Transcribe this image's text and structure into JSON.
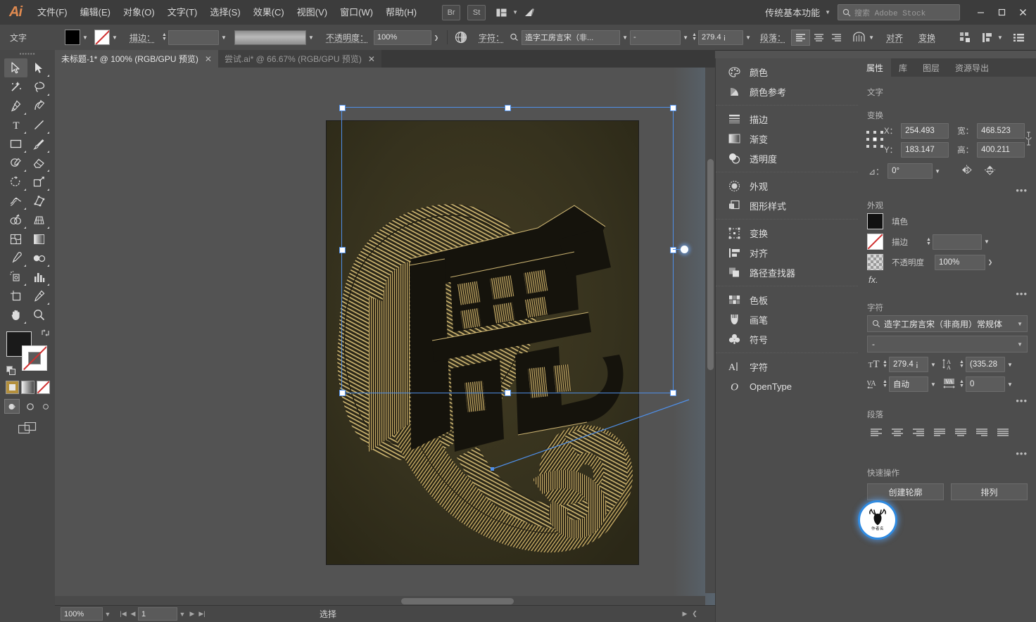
{
  "app": {
    "logo": "Ai",
    "name": "Adobe Illustrator"
  },
  "menubar": {
    "items": [
      {
        "label": "文件(F)",
        "name": "menu-file"
      },
      {
        "label": "编辑(E)",
        "name": "menu-edit"
      },
      {
        "label": "对象(O)",
        "name": "menu-object"
      },
      {
        "label": "文字(T)",
        "name": "menu-type"
      },
      {
        "label": "选择(S)",
        "name": "menu-select"
      },
      {
        "label": "效果(C)",
        "name": "menu-effect"
      },
      {
        "label": "视图(V)",
        "name": "menu-view"
      },
      {
        "label": "窗口(W)",
        "name": "menu-window"
      },
      {
        "label": "帮助(H)",
        "name": "menu-help"
      }
    ],
    "bridge_label": "Br",
    "stock_label": "St",
    "workspace": "传统基本功能",
    "search_placeholder": "搜索 Adobe Stock",
    "min": "—",
    "max": "▢",
    "close": "✕"
  },
  "controlbar": {
    "context_label": "文字",
    "fill_color": "#000000",
    "stroke_label": "描边：",
    "stroke_weight": "",
    "opacity_label": "不透明度：",
    "opacity_value": "100%",
    "char_label": "字符：",
    "font_family": "造字工房言宋（非...",
    "font_style": "-",
    "font_size": "279.4 ¡",
    "para_label": "段落：",
    "align_label": "对齐",
    "transform_label": "变换"
  },
  "tabs": [
    {
      "title": "未标题-1* @ 100% (RGB/GPU 预览)",
      "active": true,
      "close": "✕",
      "name": "doc-tab-untitled-1"
    },
    {
      "title": "尝试.ai* @ 66.67% (RGB/GPU 预览)",
      "active": false,
      "close": "✕",
      "name": "doc-tab-changshi"
    }
  ],
  "toolbar": {
    "tools": [
      {
        "name": "selection-tool",
        "glyph": "arrow",
        "selected": true,
        "flyout": false
      },
      {
        "name": "direct-selection-tool",
        "glyph": "arrow-solid",
        "selected": false,
        "flyout": true
      },
      {
        "name": "magic-wand-tool",
        "glyph": "wand",
        "selected": false,
        "flyout": false
      },
      {
        "name": "lasso-tool",
        "glyph": "lasso",
        "selected": false,
        "flyout": false
      },
      {
        "name": "pen-tool",
        "glyph": "pen",
        "selected": false,
        "flyout": true
      },
      {
        "name": "curvature-tool",
        "glyph": "curvature",
        "selected": false,
        "flyout": false
      },
      {
        "name": "type-tool",
        "glyph": "T",
        "selected": false,
        "flyout": true
      },
      {
        "name": "line-segment-tool",
        "glyph": "line",
        "selected": false,
        "flyout": true
      },
      {
        "name": "rectangle-tool",
        "glyph": "rect",
        "selected": false,
        "flyout": true
      },
      {
        "name": "paintbrush-tool",
        "glyph": "brush",
        "selected": false,
        "flyout": true
      },
      {
        "name": "shaper-pencil-tool",
        "glyph": "pencil",
        "selected": false,
        "flyout": true
      },
      {
        "name": "eraser-tool",
        "glyph": "eraser",
        "selected": false,
        "flyout": true
      },
      {
        "name": "rotate-tool",
        "glyph": "rotate",
        "selected": false,
        "flyout": true
      },
      {
        "name": "scale-tool",
        "glyph": "scale",
        "selected": false,
        "flyout": true
      },
      {
        "name": "width-tool",
        "glyph": "width",
        "selected": false,
        "flyout": true
      },
      {
        "name": "free-transform-tool",
        "glyph": "freetransform",
        "selected": false,
        "flyout": false
      },
      {
        "name": "shape-builder-tool",
        "glyph": "shapebuilder",
        "selected": false,
        "flyout": true
      },
      {
        "name": "perspective-grid-tool",
        "glyph": "perspective",
        "selected": false,
        "flyout": true
      },
      {
        "name": "mesh-tool",
        "glyph": "mesh",
        "selected": false,
        "flyout": false
      },
      {
        "name": "gradient-tool",
        "glyph": "gradient",
        "selected": false,
        "flyout": false
      },
      {
        "name": "eyedropper-tool",
        "glyph": "eyedropper",
        "selected": false,
        "flyout": true
      },
      {
        "name": "blend-tool",
        "glyph": "blend",
        "selected": false,
        "flyout": true
      },
      {
        "name": "symbol-sprayer-tool",
        "glyph": "symbolspray",
        "selected": false,
        "flyout": true
      },
      {
        "name": "column-graph-tool",
        "glyph": "graph",
        "selected": false,
        "flyout": true
      },
      {
        "name": "artboard-tool",
        "glyph": "artboard",
        "selected": false,
        "flyout": false
      },
      {
        "name": "slice-tool",
        "glyph": "slice",
        "selected": false,
        "flyout": true
      },
      {
        "name": "hand-tool",
        "glyph": "hand",
        "selected": false,
        "flyout": true
      },
      {
        "name": "zoom-tool",
        "glyph": "zoom",
        "selected": false,
        "flyout": false
      }
    ],
    "fill_color": "#1a1a1a",
    "stroke_color": "none",
    "draw_modes": [
      "draw-normal",
      "draw-behind",
      "draw-inside"
    ],
    "color_modes": [
      "color",
      "gradient",
      "none"
    ]
  },
  "canvas": {
    "artwork_title": "鹿",
    "artboard_bg": "#332f1d",
    "line_color": "#cbb26a",
    "selection_color": "#4f8fe8"
  },
  "statusbar": {
    "zoom": "100%",
    "page": "1",
    "tool": "选择"
  },
  "dock": {
    "groups": [
      {
        "items": [
          {
            "label": "颜色",
            "name": "panel-color",
            "icon": "palette-icon"
          },
          {
            "label": "颜色参考",
            "name": "panel-color-guide",
            "icon": "color-guide-icon"
          }
        ]
      },
      {
        "items": [
          {
            "label": "描边",
            "name": "panel-stroke",
            "icon": "stroke-icon"
          },
          {
            "label": "渐变",
            "name": "panel-gradient",
            "icon": "gradient-icon"
          },
          {
            "label": "透明度",
            "name": "panel-transparency",
            "icon": "transparency-icon"
          }
        ]
      },
      {
        "items": [
          {
            "label": "外观",
            "name": "panel-appearance",
            "icon": "appearance-icon"
          },
          {
            "label": "图形样式",
            "name": "panel-graphic-styles",
            "icon": "graphic-styles-icon"
          }
        ]
      },
      {
        "items": [
          {
            "label": "变换",
            "name": "panel-transform",
            "icon": "transform-icon"
          },
          {
            "label": "对齐",
            "name": "panel-align",
            "icon": "align-icon"
          },
          {
            "label": "路径查找器",
            "name": "panel-pathfinder",
            "icon": "pathfinder-icon"
          }
        ]
      },
      {
        "items": [
          {
            "label": "色板",
            "name": "panel-swatches",
            "icon": "swatches-icon"
          },
          {
            "label": "画笔",
            "name": "panel-brushes",
            "icon": "brushes-icon"
          },
          {
            "label": "符号",
            "name": "panel-symbols",
            "icon": "symbols-icon"
          }
        ]
      },
      {
        "items": [
          {
            "label": "字符",
            "name": "panel-character",
            "icon": "character-icon"
          },
          {
            "label": "OpenType",
            "name": "panel-opentype",
            "icon": "opentype-icon"
          }
        ]
      }
    ]
  },
  "properties": {
    "tabs": [
      {
        "label": "属性",
        "active": true,
        "name": "tab-properties"
      },
      {
        "label": "库",
        "active": false,
        "name": "tab-libraries"
      },
      {
        "label": "图层",
        "active": false,
        "name": "tab-layers"
      },
      {
        "label": "资源导出",
        "active": false,
        "name": "tab-asset-export"
      }
    ],
    "object_type": "文字",
    "transform": {
      "heading": "变换",
      "x_label": "X：",
      "x_value": "254.493",
      "y_label": "Y：",
      "y_value": "183.147",
      "w_label": "宽：",
      "w_value": "468.523",
      "h_label": "高：",
      "h_value": "400.211",
      "angle_label": "⊿：",
      "angle_value": "0°"
    },
    "appearance": {
      "heading": "外观",
      "fill_label": "填色",
      "stroke_label": "描边",
      "stroke_weight": "",
      "opacity_label": "不透明度",
      "opacity_value": "100%",
      "fx_label": "fx."
    },
    "character": {
      "heading": "字符",
      "font_family": "造字工房言宋（非商用）常规体",
      "font_style": "-",
      "size_value": "279.4 ¡",
      "leading_value": "(335.28",
      "kerning_value": "自动",
      "tracking_value": "0"
    },
    "paragraph": {
      "heading": "段落"
    },
    "quick_actions": {
      "heading": "快速操作",
      "buttons": [
        {
          "label": "创建轮廓",
          "name": "create-outlines-button"
        },
        {
          "label": "排列",
          "name": "arrange-button"
        }
      ]
    },
    "watermark": {
      "sub": "作者名"
    }
  }
}
